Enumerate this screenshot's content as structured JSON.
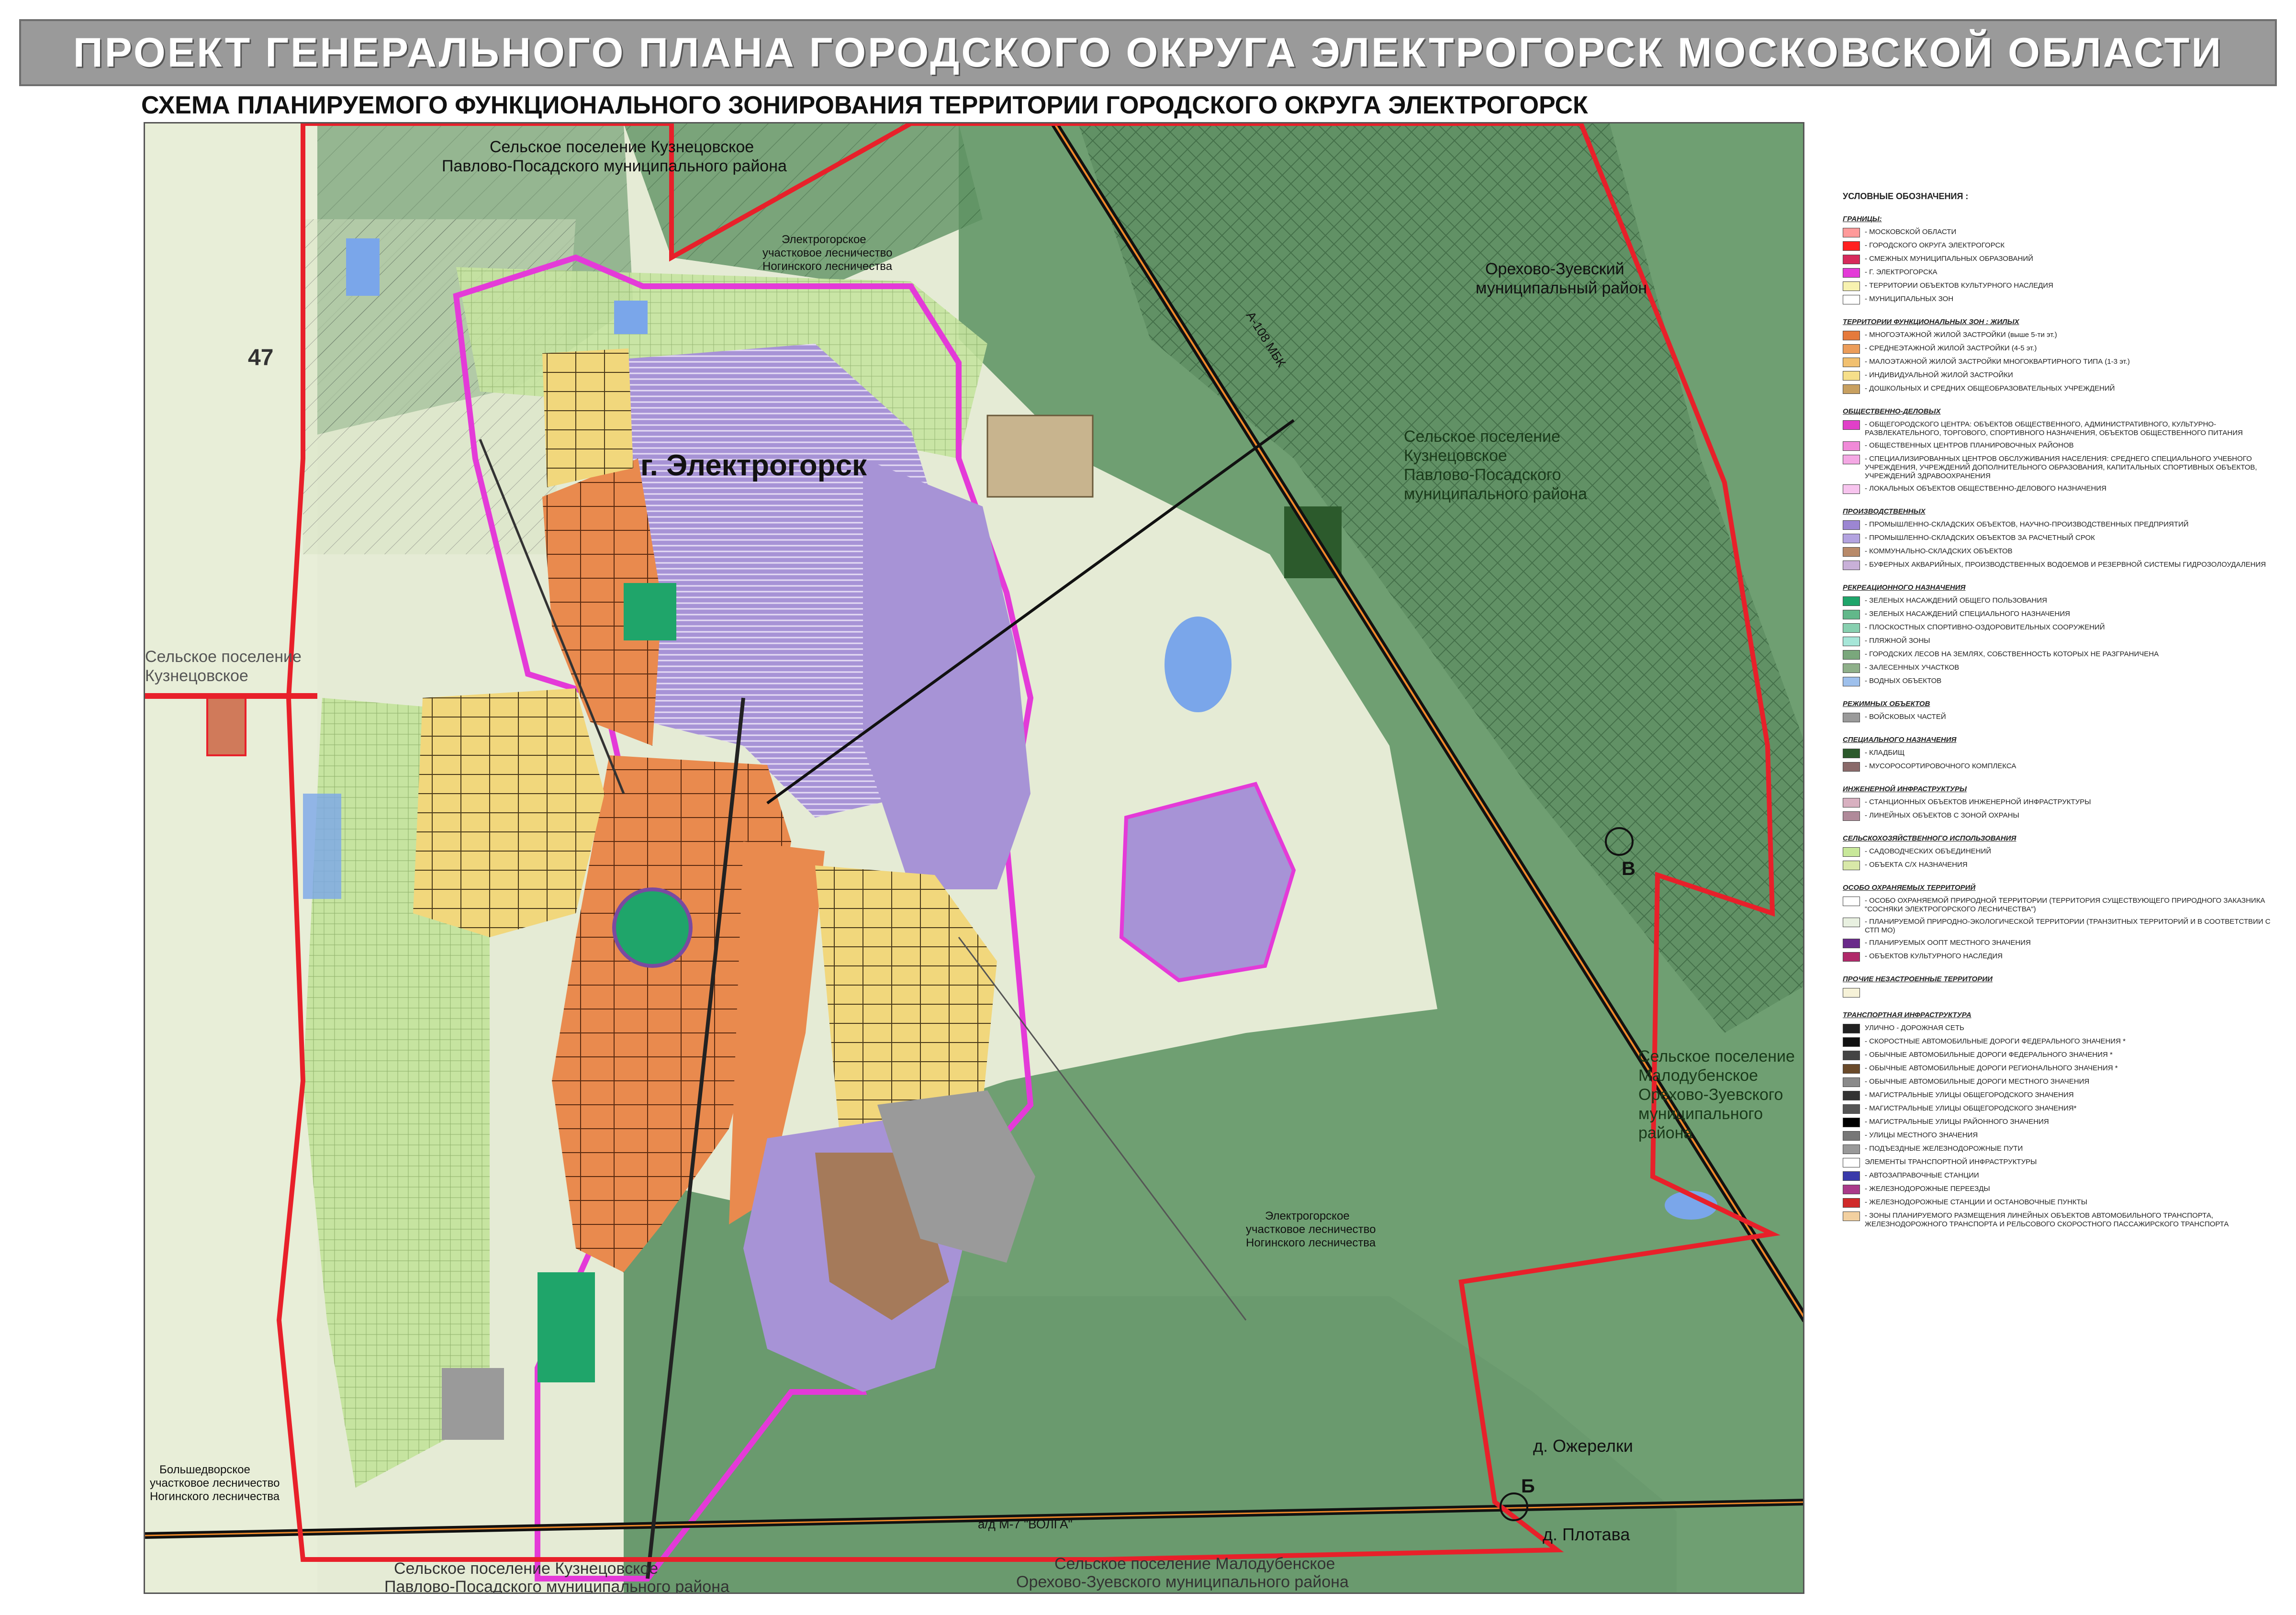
{
  "header": {
    "title": "ПРОЕКТ ГЕНЕРАЛЬНОГО ПЛАНА ГОРОДСКОГО ОКРУГА ЭЛЕКТРОГОРСК МОСКОВСКОЙ ОБЛАСТИ",
    "subtitle": "СХЕМА ПЛАНИРУЕМОГО ФУНКЦИОНАЛЬНОГО ЗОНИРОВАНИЯ ТЕРРИТОРИИ ГОРОДСКОГО ОКРУГА ЭЛЕКТРОГОРСК"
  },
  "map": {
    "labels": {
      "city": "г. Электрогорск",
      "kuznetsovskoe_top": "Сельское поселение Кузнецовское",
      "pavlovo_top": "Павлово-Посадского муниципального района",
      "forestry_top_1": "Электрогорское",
      "forestry_top_2": "участковое лесничество",
      "forestry_top_3": "Ногинского лесничества",
      "orekhovo_1": "Орехово-Зуевский",
      "orekhovo_2": "муниципальный район",
      "kuz_right_1": "Сельское поселение",
      "kuz_right_2": "Кузнецовское",
      "kuz_right_3": "Павлово-Посадского",
      "kuz_right_4": "муниципального района",
      "kuz_left_1": "Сельское поселение",
      "kuz_left_2": "Кузнецовское",
      "malod_1": "Сельское поселение",
      "malod_2": "Малодубенское",
      "malod_3": "Орехово-Зуевского",
      "malod_4": "муниципального",
      "malod_5": "района",
      "forestry_mid_1": "Электрогорское",
      "forestry_mid_2": "участковое лесничество",
      "forestry_mid_3": "Ногинского лесничества",
      "bolsh_1": "Большедворское",
      "bolsh_2": "участковое лесничество",
      "bolsh_3": "Ногинского лесничества",
      "bottom_kuz_1": "Сельское поселение Кузнецовское",
      "bottom_kuz_2": "Павлово-Посадского муниципального района",
      "bottom_malod_1": "Сельское поселение Малодубенское",
      "bottom_malod_2": "Орехово-Зуевского муниципального района",
      "ozherelki": "д. Ожерелки",
      "plotava": "д. Плотава",
      "road_a108": "А-108 МБК",
      "road_m7": "а/д М-7 \"ВОЛГА\"",
      "num_47": "47",
      "point_v": "В",
      "point_b": "Б"
    },
    "colors": {
      "forest": "#6f9f72",
      "forest_dark": "#5d8d61",
      "light_green": "#c6e4a0",
      "residential_yellow": "#f1d77c",
      "residential_orange": "#e98a4e",
      "industrial_purple": "#a793d6",
      "boundary_red": "#e8202a",
      "city_magenta": "#e43ad8",
      "water": "#7aa6ea",
      "industrial_brown": "#a57a5a"
    }
  },
  "legend": {
    "title": "УСЛОВНЫЕ ОБОЗНАЧЕНИЯ :",
    "sections": [
      {
        "heading": "ГРАНИЦЫ:",
        "items": [
          {
            "color": "#ff9a9a",
            "label": "- МОСКОВСКОЙ ОБЛАСТИ"
          },
          {
            "color": "#ff2020",
            "label": "- ГОРОДСКОГО ОКРУГА ЭЛЕКТРОГОРСК"
          },
          {
            "color": "#d62a5c",
            "label": "- СМЕЖНЫХ МУНИЦИПАЛЬНЫХ ОБРАЗОВАНИЙ"
          },
          {
            "color": "#e43ad8",
            "label": "- Г. ЭЛЕКТРОГОРСКА"
          },
          {
            "color": "#f7f2b0",
            "label": "- ТЕРРИТОРИИ ОБЪЕКТОВ КУЛЬТУРНОГО НАСЛЕДИЯ"
          },
          {
            "color": "#ffffff",
            "label": "- МУНИЦИПАЛЬНЫХ ЗОН"
          }
        ]
      },
      {
        "heading": "ТЕРРИТОРИИ ФУНКЦИОНАЛЬНЫХ ЗОН : ЖИЛЫХ",
        "items": [
          {
            "color": "#e57a3d",
            "label": "- МНОГОЭТАЖНОЙ ЖИЛОЙ ЗАСТРОЙКИ (выше 5-ти эт.)"
          },
          {
            "color": "#ec9d5a",
            "label": "- СРЕДНЕЭТАЖНОЙ ЖИЛОЙ ЗАСТРОЙКИ (4-5 эт.)"
          },
          {
            "color": "#f1c070",
            "label": "- МАЛОЭТАЖНОЙ ЖИЛОЙ ЗАСТРОЙКИ МНОГОКВАРТИРНОГО ТИПА (1-3 эт.)"
          },
          {
            "color": "#f6df8a",
            "label": "- ИНДИВИДУАЛЬНОЙ ЖИЛОЙ ЗАСТРОЙКИ"
          },
          {
            "color": "#c8a060",
            "label": "- ДОШКОЛЬНЫХ И СРЕДНИХ ОБЩЕОБРАЗОВАТЕЛЬНЫХ УЧРЕЖДЕНИЙ"
          }
        ]
      },
      {
        "heading": "ОБЩЕСТВЕННО-ДЕЛОВЫХ",
        "items": [
          {
            "color": "#e040c8",
            "label": "- ОБЩЕГОРОДСКОГО ЦЕНТРА: ОБЪЕКТОВ ОБЩЕСТВЕННОГО, АДМИНИСТРАТИВНОГО, КУЛЬТУРНО-РАЗВЛЕКАТЕЛЬНОГО, ТОРГОВОГО, СПОРТИВНОГО НАЗНАЧЕНИЯ, ОБЪЕКТОВ ОБЩЕСТВЕННОГО ПИТАНИЯ"
          },
          {
            "color": "#f08ad8",
            "label": "- ОБЩЕСТВЕННЫХ ЦЕНТРОВ ПЛАНИРОВОЧНЫХ РАЙОНОВ"
          },
          {
            "color": "#f4a8e4",
            "label": "- СПЕЦИАЛИЗИРОВАННЫХ ЦЕНТРОВ ОБСЛУЖИВАНИЯ НАСЕЛЕНИЯ: СРЕДНЕГО СПЕЦИАЛЬНОГО УЧЕБНОГО УЧРЕЖДЕНИЯ, УЧРЕЖДЕНИЙ ДОПОЛНИТЕЛЬНОГО ОБРАЗОВАНИЯ, КАПИТАЛЬНЫХ СПОРТИВНЫХ ОБЪЕКТОВ, УЧРЕЖДЕНИЙ ЗДРАВООХРАНЕНИЯ"
          },
          {
            "color": "#f7c4ee",
            "label": "- ЛОКАЛЬНЫХ ОБЪЕКТОВ ОБЩЕСТВЕННО-ДЕЛОВОГО НАЗНАЧЕНИЯ"
          }
        ]
      },
      {
        "heading": "ПРОИЗВОДСТВЕННЫХ",
        "items": [
          {
            "color": "#9c86d2",
            "label": "- ПРОМЫШЛЕННО-СКЛАДСКИХ ОБЪЕКТОВ, НАУЧНО-ПРОИЗВОДСТВЕННЫХ ПРЕДПРИЯТИЙ"
          },
          {
            "color": "#b3a3e0",
            "label": "- ПРОМЫШЛЕННО-СКЛАДСКИХ ОБЪЕКТОВ ЗА РАСЧЕТНЫЙ СРОК"
          },
          {
            "color": "#b88a6a",
            "label": "- КОММУНАЛЬНО-СКЛАДСКИХ ОБЪЕКТОВ"
          },
          {
            "color": "#c8b0d8",
            "label": "- БУФЕРНЫХ АКВАРИЙНЫХ, ПРОИЗВОДСТВЕННЫХ ВОДОЕМОВ И РЕЗЕРВНОЙ СИСТЕМЫ ГИДРОЗОЛОУДАЛЕНИЯ"
          }
        ]
      },
      {
        "heading": "РЕКРЕАЦИОННОГО НАЗНАЧЕНИЯ",
        "items": [
          {
            "color": "#1fa56a",
            "label": "- ЗЕЛЕНЫХ НАСАЖДЕНИЙ ОБЩЕГО ПОЛЬЗОВАНИЯ"
          },
          {
            "color": "#62b88a",
            "label": "- ЗЕЛЕНЫХ НАСАЖДЕНИЙ СПЕЦИАЛЬНОГО НАЗНАЧЕНИЯ"
          },
          {
            "color": "#88d0b0",
            "label": "- ПЛОСКОСТНЫХ СПОРТИВНО-ОЗДОРОВИТЕЛЬНЫХ СООРУЖЕНИЙ"
          },
          {
            "color": "#a6e6d8",
            "label": "- ПЛЯЖНОЙ ЗОНЫ"
          },
          {
            "color": "#7aa77c",
            "label": "- ГОРОДСКИХ ЛЕСОВ НА ЗЕМЛЯХ, СОБСТВЕННОСТЬ КОТОРЫХ НЕ РАЗГРАНИЧЕНА"
          },
          {
            "color": "#8fb08a",
            "label": "- ЗАЛЕСЕННЫХ УЧАСТКОВ"
          },
          {
            "color": "#9ec0ec",
            "label": "- ВОДНЫХ ОБЪЕКТОВ"
          }
        ]
      },
      {
        "heading": "РЕЖИМНЫХ ОБЪЕКТОВ",
        "items": [
          {
            "color": "#9a9a9a",
            "label": "- ВОЙСКОВЫХ ЧАСТЕЙ"
          }
        ]
      },
      {
        "heading": "СПЕЦИАЛЬНОГО НАЗНАЧЕНИЯ",
        "items": [
          {
            "color": "#2c5a2c",
            "label": "- КЛАДБИЩ"
          },
          {
            "color": "#8a6a6a",
            "label": "- МУСОРОСОРТИРОВОЧНОГО КОМПЛЕКСА"
          }
        ]
      },
      {
        "heading": "ИНЖЕНЕРНОЙ ИНФРАСТРУКТУРЫ",
        "items": [
          {
            "color": "#d8b0c0",
            "label": "- СТАНЦИОННЫХ ОБЪЕКТОВ ИНЖЕНЕРНОЙ ИНФРАСТРУКТУРЫ"
          },
          {
            "color": "#b08a9a",
            "label": "- ЛИНЕЙНЫХ ОБЪЕКТОВ С ЗОНОЙ ОХРАНЫ"
          }
        ]
      },
      {
        "heading": "СЕЛЬСКОХОЗЯЙСТВЕННОГО ИСПОЛЬЗОВАНИЯ",
        "items": [
          {
            "color": "#c8e89a",
            "label": "- САДОВОДЧЕСКИХ ОБЪЕДИНЕНИЙ"
          },
          {
            "color": "#d8e8a8",
            "label": "- ОБЪЕКТА С/Х НАЗНАЧЕНИЯ"
          }
        ]
      },
      {
        "heading": "ОСОБО ОХРАНЯЕМЫХ ТЕРРИТОРИЙ",
        "items": [
          {
            "color": "#ffffff",
            "label": "- ОСОБО ОХРАНЯЕМОЙ ПРИРОДНОЙ ТЕРРИТОРИИ (ТЕРРИТОРИЯ СУЩЕСТВУЮЩЕГО ПРИРОДНОГО ЗАКАЗНИКА \"СОСНЯКИ ЭЛЕКТРОГОРСКОГО ЛЕСНИЧЕСТВА\")"
          },
          {
            "color": "#e8f0e0",
            "label": "- ПЛАНИРУЕМОЙ ПРИРОДНО-ЭКОЛОГИЧЕСКОЙ ТЕРРИТОРИИ (ТРАНЗИТНЫХ ТЕРРИТОРИЙ И В СООТВЕТСТВИИ С СТП МО)"
          },
          {
            "color": "#6a2a8a",
            "label": "- ПЛАНИРУЕМЫХ ООПТ МЕСТНОГО ЗНАЧЕНИЯ"
          },
          {
            "color": "#b02a6a",
            "label": "- ОБЪЕКТОВ КУЛЬТУРНОГО НАСЛЕДИЯ"
          }
        ]
      },
      {
        "heading": "ПРОЧИЕ НЕЗАСТРОЕННЫЕ ТЕРРИТОРИИ",
        "items": [
          {
            "color": "#f6f2d8",
            "label": ""
          }
        ]
      },
      {
        "heading": "ТРАНСПОРТНАЯ ИНФРАСТРУКТУРА",
        "items": [
          {
            "color": "#222222",
            "label": "УЛИЧНО - ДОРОЖНАЯ СЕТЬ"
          },
          {
            "color": "#111111",
            "label": "- СКОРОСТНЫЕ АВТОМОБИЛЬНЫЕ ДОРОГИ ФЕДЕРАЛЬНОГО ЗНАЧЕНИЯ *"
          },
          {
            "color": "#444444",
            "label": "- ОБЫЧНЫЕ АВТОМОБИЛЬНЫЕ ДОРОГИ ФЕДЕРАЛЬНОГО ЗНАЧЕНИЯ *"
          },
          {
            "color": "#6a4a2a",
            "label": "- ОБЫЧНЫЕ АВТОМОБИЛЬНЫЕ ДОРОГИ РЕГИОНАЛЬНОГО ЗНАЧЕНИЯ *"
          },
          {
            "color": "#8a8a8a",
            "label": "- ОБЫЧНЫЕ АВТОМОБИЛЬНЫЕ ДОРОГИ МЕСТНОГО ЗНАЧЕНИЯ"
          },
          {
            "color": "#333333",
            "label": "- МАГИСТРАЛЬНЫЕ УЛИЦЫ ОБЩЕГОРОДСКОГО ЗНАЧЕНИЯ"
          },
          {
            "color": "#555555",
            "label": "- МАГИСТРАЛЬНЫЕ УЛИЦЫ ОБЩЕГОРОДСКОГО ЗНАЧЕНИЯ*"
          },
          {
            "color": "#000000",
            "label": "- МАГИСТРАЛЬНЫЕ УЛИЦЫ РАЙОННОГО ЗНАЧЕНИЯ"
          },
          {
            "color": "#777777",
            "label": "- УЛИЦЫ МЕСТНОГО ЗНАЧЕНИЯ"
          },
          {
            "color": "#999999",
            "label": "- ПОДЪЕЗДНЫЕ ЖЕЛЕЗНОДОРОЖНЫЕ ПУТИ"
          },
          {
            "color": "#ffffff",
            "label": "ЭЛЕМЕНТЫ ТРАНСПОРТНОЙ ИНФРАСТРУКТУРЫ"
          },
          {
            "color": "#3a3aaa",
            "label": "- АВТОЗАПРАВОЧНЫЕ СТАНЦИИ"
          },
          {
            "color": "#aa3a8a",
            "label": "- ЖЕЛЕЗНОДОРОЖНЫЕ ПЕРЕЕЗДЫ"
          },
          {
            "color": "#d02a2a",
            "label": "- ЖЕЛЕЗНОДОРОЖНЫЕ СТАНЦИИ И ОСТАНОВОЧНЫЕ ПУНКТЫ"
          },
          {
            "color": "#f2d0a0",
            "label": "- ЗОНЫ ПЛАНИРУЕМОГО РАЗМЕЩЕНИЯ ЛИНЕЙНЫХ ОБЪЕКТОВ АВТОМОБИЛЬНОГО ТРАНСПОРТА, ЖЕЛЕЗНОДОРОЖНОГО ТРАНСПОРТА И РЕЛЬСОВОГО СКОРОСТНОГО ПАССАЖИРСКОГО ТРАНСПОРТА"
          }
        ]
      }
    ]
  }
}
